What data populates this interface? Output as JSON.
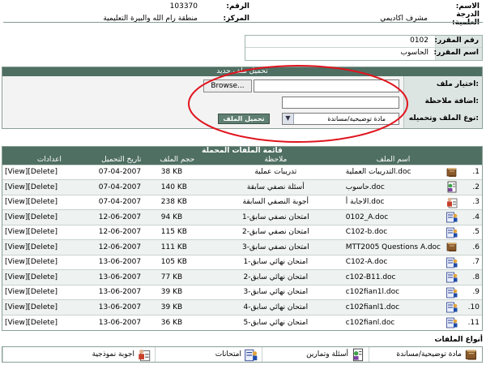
{
  "header": {
    "name_label": "الاسم:",
    "name_value": "",
    "number_label": "الرقم:",
    "number_value": "103370",
    "degree_label": "الدرجة العلمية:",
    "degree_value": "مشرف اكاديمي",
    "center_label": "المركز:",
    "center_value": "منطقة رام الله والبيرة التعليمية"
  },
  "course": {
    "number_label": "رقم المقرر:",
    "number_value": "0102",
    "name_label": "اسم المقرر:",
    "name_value": "الحاسوب"
  },
  "upload": {
    "title": "تحميل ملف جديد",
    "choose_label": "اختيار ملف:",
    "note_label": "اضافة ملاحظة:",
    "type_label": "نوع الملف وتحميله:",
    "browse_label": "Browse...",
    "file_value": "",
    "note_value": "",
    "type_selected": "مادة توضيحية/مساندة",
    "submit_label": "تحميل الملف"
  },
  "files": {
    "title": "قائمة الملفات المحملة",
    "headers": [
      "اسم الملف",
      "ملاحظة",
      "حجم الملف",
      "تاريخ التحميل",
      "اعدادات"
    ],
    "rows": [
      {
        "num": "1.",
        "name": "التدريبات العملية.doc",
        "note": "تدريبات عملية",
        "size": "38 KB",
        "date": "07-04-2007",
        "actions": "[View][Delete]",
        "icon": "book-icon"
      },
      {
        "num": "2.",
        "name": "حاسوب.doc",
        "note": "أسئلة نصفي سابقة",
        "size": "140 KB",
        "date": "07-04-2007",
        "actions": "[View][Delete]",
        "icon": "worksheet-icon"
      },
      {
        "num": "3.",
        "name": "الاجابة أ.doc",
        "note": "أجوبة النصفي السابقة",
        "size": "238 KB",
        "date": "07-04-2007",
        "actions": "[View][Delete]",
        "icon": "answers-icon"
      },
      {
        "num": "4.",
        "name": "0102_A.doc",
        "note": "امتحان نصفي سابق-1",
        "size": "94 KB",
        "date": "12-06-2007",
        "actions": "[View][Delete]",
        "icon": "exam-icon"
      },
      {
        "num": "5.",
        "name": "C102-b.doc",
        "note": "امتحان نصفي سابق-2",
        "size": "115 KB",
        "date": "12-06-2007",
        "actions": "[View][Delete]",
        "icon": "exam-icon"
      },
      {
        "num": "6.",
        "name": "MTT2005 Questions A.doc",
        "note": "امتحان نصفي سابق-3",
        "size": "111 KB",
        "date": "12-06-2007",
        "actions": "[View][Delete]",
        "icon": "book-icon"
      },
      {
        "num": "7.",
        "name": "C102-A.doc",
        "note": "امتحان نهائي سابق-1",
        "size": "105 KB",
        "date": "13-06-2007",
        "actions": "[View][Delete]",
        "icon": "exam-icon"
      },
      {
        "num": "8.",
        "name": "c102-B11.doc",
        "note": "امتحان نهائي سابق-2",
        "size": "77 KB",
        "date": "13-06-2007",
        "actions": "[View][Delete]",
        "icon": "exam-icon"
      },
      {
        "num": "9.",
        "name": "c102fian1l.doc",
        "note": "امتحان نهائي سابق-3",
        "size": "39 KB",
        "date": "13-06-2007",
        "actions": "[View][Delete]",
        "icon": "exam-icon"
      },
      {
        "num": "10.",
        "name": "c102fianl1.doc",
        "note": "امتحان نهائي سابق-4",
        "size": "39 KB",
        "date": "13-06-2007",
        "actions": "[View][Delete]",
        "icon": "exam-icon"
      },
      {
        "num": "11.",
        "name": "c102fianl.doc",
        "note": "امتحان نهائي سابق-5",
        "size": "36 KB",
        "date": "13-06-2007",
        "actions": "[View][Delete]",
        "icon": "exam-icon"
      }
    ]
  },
  "types": {
    "title": "أنواع الملفات",
    "items": [
      {
        "label": "مادة توضيحية/مساندة",
        "icon": "book-icon"
      },
      {
        "label": "أسئلة وتمارين",
        "icon": "worksheet-icon"
      },
      {
        "label": "امتحانات",
        "icon": "exam-icon"
      },
      {
        "label": "اجوبة نموذجية",
        "icon": "answers-icon"
      }
    ]
  },
  "colors": {
    "header_green": "#4f6f63",
    "label_bg": "#dde5e2",
    "highlight_red": "#e0141e"
  }
}
